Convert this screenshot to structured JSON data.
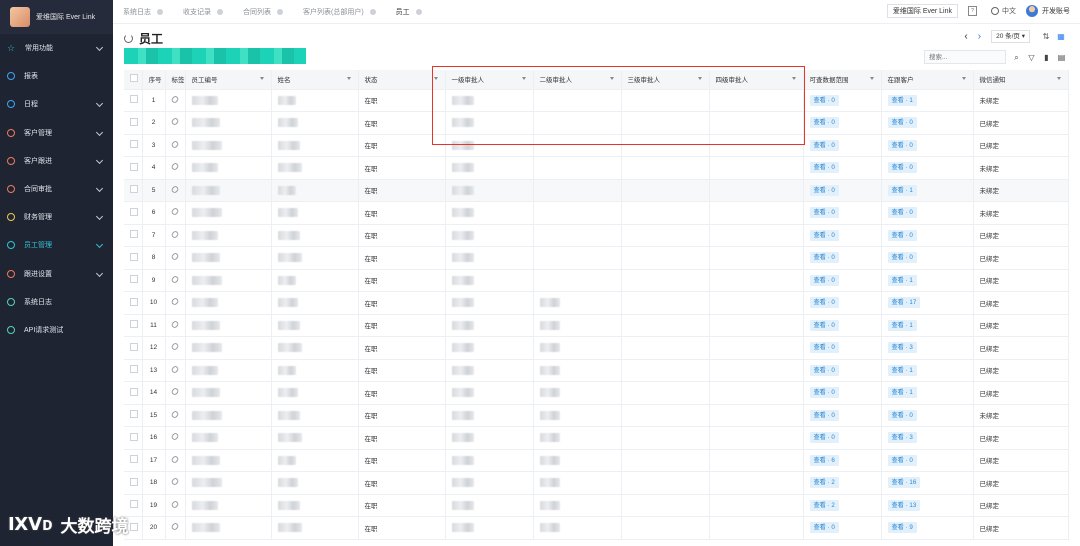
{
  "brand": {
    "name": "爱维国际 Ever Link"
  },
  "sidebar": {
    "items": [
      {
        "label": "常用功能",
        "chevron": true,
        "icon": "star-icon"
      },
      {
        "label": "报表",
        "chevron": false,
        "icon": "circle-icon"
      },
      {
        "label": "日程",
        "chevron": true,
        "icon": "circle-icon"
      },
      {
        "label": "客户管理",
        "chevron": true,
        "icon": "circle-icon"
      },
      {
        "label": "客户跟进",
        "chevron": true,
        "icon": "circle-icon"
      },
      {
        "label": "合同审批",
        "chevron": true,
        "icon": "circle-icon"
      },
      {
        "label": "财务管理",
        "chevron": true,
        "icon": "circle-icon"
      },
      {
        "label": "员工管理",
        "chevron": true,
        "icon": "circle-icon",
        "active": true
      },
      {
        "label": "跟进设置",
        "chevron": true,
        "icon": "circle-icon"
      },
      {
        "label": "系统日志",
        "chevron": false,
        "icon": "circle-icon"
      },
      {
        "label": "API请求测试",
        "chevron": false,
        "icon": "circle-icon"
      }
    ]
  },
  "topbar": {
    "tabs": [
      {
        "label": "系统日志"
      },
      {
        "label": "收支记录"
      },
      {
        "label": "合同列表"
      },
      {
        "label": "客户列表(总部用户)"
      },
      {
        "label": "员工",
        "active": true
      }
    ],
    "tenant": "爱维国际 Ever Link",
    "doc_icon_text": "?",
    "language": "中文",
    "account": "开发账号"
  },
  "page": {
    "title": "员工",
    "page_size": "20 条/页",
    "search_placeholder": "搜索..."
  },
  "table": {
    "headers": {
      "index": "序号",
      "tag": "标签",
      "emp_no": "员工编号",
      "name": "姓名",
      "status": "状态",
      "approver1": "一级审批人",
      "approver2": "二级审批人",
      "approver3": "三级审批人",
      "approver4": "四级审批人",
      "data_scope": "可查数据范围",
      "owned_customers": "在跟客户",
      "wechat": "微信通知"
    },
    "rows": [
      {
        "index": "1",
        "status": "在职",
        "scope": "查看 · 0",
        "customers": "查看 · 1",
        "wechat": "未绑定",
        "a2": false
      },
      {
        "index": "2",
        "status": "在职",
        "scope": "查看 · 0",
        "customers": "查看 · 0",
        "wechat": "已绑定",
        "a2": false
      },
      {
        "index": "3",
        "status": "在职",
        "scope": "查看 · 0",
        "customers": "查看 · 0",
        "wechat": "已绑定",
        "a2": false
      },
      {
        "index": "4",
        "status": "在职",
        "scope": "查看 · 0",
        "customers": "查看 · 0",
        "wechat": "未绑定",
        "a2": false
      },
      {
        "index": "5",
        "status": "在职",
        "scope": "查看 · 0",
        "customers": "查看 · 1",
        "wechat": "未绑定",
        "a2": false
      },
      {
        "index": "6",
        "status": "在职",
        "scope": "查看 · 0",
        "customers": "查看 · 0",
        "wechat": "未绑定",
        "a2": false
      },
      {
        "index": "7",
        "status": "在职",
        "scope": "查看 · 0",
        "customers": "查看 · 0",
        "wechat": "已绑定",
        "a2": false
      },
      {
        "index": "8",
        "status": "在职",
        "scope": "查看 · 0",
        "customers": "查看 · 0",
        "wechat": "已绑定",
        "a2": false
      },
      {
        "index": "9",
        "status": "在职",
        "scope": "查看 · 0",
        "customers": "查看 · 1",
        "wechat": "已绑定",
        "a2": false
      },
      {
        "index": "10",
        "status": "在职",
        "scope": "查看 · 0",
        "customers": "查看 · 17",
        "wechat": "已绑定",
        "a2": true
      },
      {
        "index": "11",
        "status": "在职",
        "scope": "查看 · 0",
        "customers": "查看 · 1",
        "wechat": "已绑定",
        "a2": true
      },
      {
        "index": "12",
        "status": "在职",
        "scope": "查看 · 0",
        "customers": "查看 · 3",
        "wechat": "已绑定",
        "a2": true
      },
      {
        "index": "13",
        "status": "在职",
        "scope": "查看 · 0",
        "customers": "查看 · 1",
        "wechat": "已绑定",
        "a2": true
      },
      {
        "index": "14",
        "status": "在职",
        "scope": "查看 · 0",
        "customers": "查看 · 1",
        "wechat": "已绑定",
        "a2": true
      },
      {
        "index": "15",
        "status": "在职",
        "scope": "查看 · 0",
        "customers": "查看 · 0",
        "wechat": "未绑定",
        "a2": true
      },
      {
        "index": "16",
        "status": "在职",
        "scope": "查看 · 0",
        "customers": "查看 · 3",
        "wechat": "已绑定",
        "a2": true
      },
      {
        "index": "17",
        "status": "在职",
        "scope": "查看 · 6",
        "customers": "查看 · 0",
        "wechat": "已绑定",
        "a2": true
      },
      {
        "index": "18",
        "status": "在职",
        "scope": "查看 · 2",
        "customers": "查看 · 16",
        "wechat": "已绑定",
        "a2": true
      },
      {
        "index": "19",
        "status": "在职",
        "scope": "查看 · 2",
        "customers": "查看 · 13",
        "wechat": "已绑定",
        "a2": true
      },
      {
        "index": "20",
        "status": "在职",
        "scope": "查看 · 0",
        "customers": "查看 · 9",
        "wechat": "已绑定",
        "a2": true
      }
    ]
  },
  "watermark": {
    "logo": "ⅨⅤᴅ",
    "text": "大数跨境"
  },
  "colors": {
    "sidebar_bg": "#1f2433",
    "accent": "#31c4d4",
    "highlight_box": "#e5352b",
    "badge_bg": "#e1f0fb",
    "badge_text": "#2a87d6"
  }
}
